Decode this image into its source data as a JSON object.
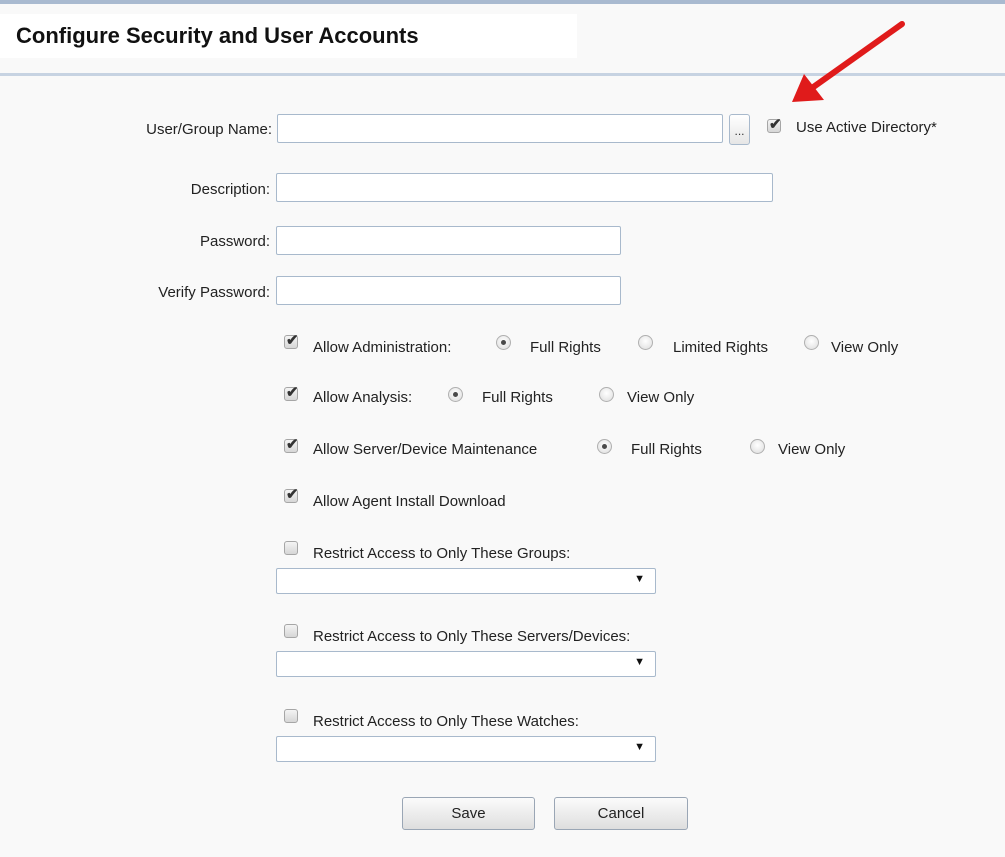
{
  "header": {
    "title": "Configure Security and User Accounts"
  },
  "form": {
    "user_group_name": {
      "label": "User/Group Name:",
      "value": "",
      "browse_label": "..."
    },
    "use_active_directory": {
      "label": "Use Active Directory*",
      "checked": true
    },
    "description": {
      "label": "Description:",
      "value": ""
    },
    "password": {
      "label": "Password:",
      "value": ""
    },
    "verify_password": {
      "label": "Verify Password:",
      "value": ""
    },
    "allow_administration": {
      "label": "Allow Administration:",
      "checked": true,
      "options": [
        "Full Rights",
        "Limited Rights",
        "View Only"
      ],
      "selected": "Full Rights"
    },
    "allow_analysis": {
      "label": "Allow Analysis:",
      "checked": true,
      "options": [
        "Full Rights",
        "View Only"
      ],
      "selected": "Full Rights"
    },
    "allow_maintenance": {
      "label": "Allow Server/Device Maintenance",
      "checked": true,
      "options": [
        "Full Rights",
        "View Only"
      ],
      "selected": "Full Rights"
    },
    "allow_agent_install": {
      "label": "Allow Agent Install Download",
      "checked": true
    },
    "restrict_groups": {
      "label": "Restrict Access to Only These Groups:",
      "checked": false,
      "selected": ""
    },
    "restrict_servers": {
      "label": "Restrict Access to Only These Servers/Devices:",
      "checked": false,
      "selected": ""
    },
    "restrict_watches": {
      "label": "Restrict Access to Only These Watches:",
      "checked": false,
      "selected": ""
    }
  },
  "actions": {
    "save_label": "Save",
    "cancel_label": "Cancel"
  },
  "colors": {
    "annotation_arrow": "#e01b1b",
    "field_border": "#a8b9cc",
    "rule": "#c7d3e2"
  },
  "icons": {
    "checkmark": "check-icon",
    "dropdown": "dropdown-arrow-icon",
    "annotation": "red-arrow-icon"
  }
}
